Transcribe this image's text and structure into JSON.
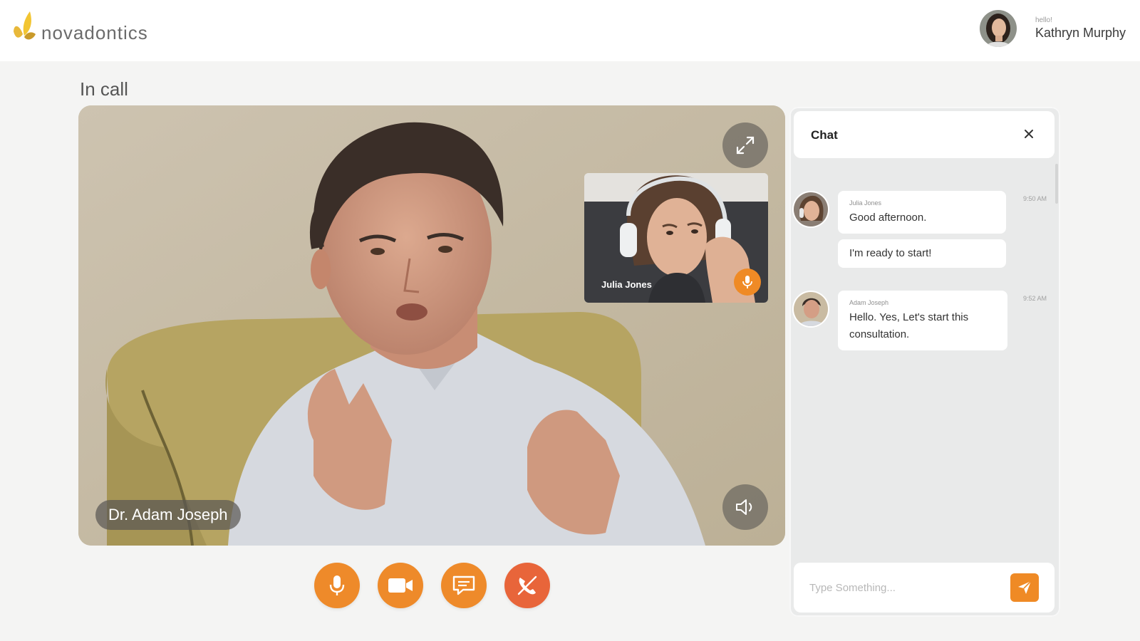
{
  "app": {
    "logo_text": "novadontics"
  },
  "user": {
    "greeting": "hello!",
    "name": "Kathryn Murphy"
  },
  "page": {
    "title": "In call"
  },
  "call": {
    "main_participant": "Dr. Adam Joseph",
    "pip_participant": "Julia Jones",
    "controls": [
      "mic-icon",
      "video-camera-icon",
      "chat-icon",
      "end-call-icon"
    ]
  },
  "chat": {
    "title": "Chat",
    "messages": [
      {
        "sender": "Julia Jones",
        "time": "9:50 AM",
        "texts": [
          "Good afternoon.",
          "I'm ready to start!"
        ]
      },
      {
        "sender": "Adam Joseph",
        "time": "9:52 AM",
        "texts": [
          "Hello. Yes, Let's start this",
          "consultation."
        ]
      }
    ],
    "input_placeholder": "Type Something..."
  },
  "colors": {
    "accent": "#ef8a25",
    "end_call": "#e8653a",
    "panel": "#e9eaea"
  }
}
